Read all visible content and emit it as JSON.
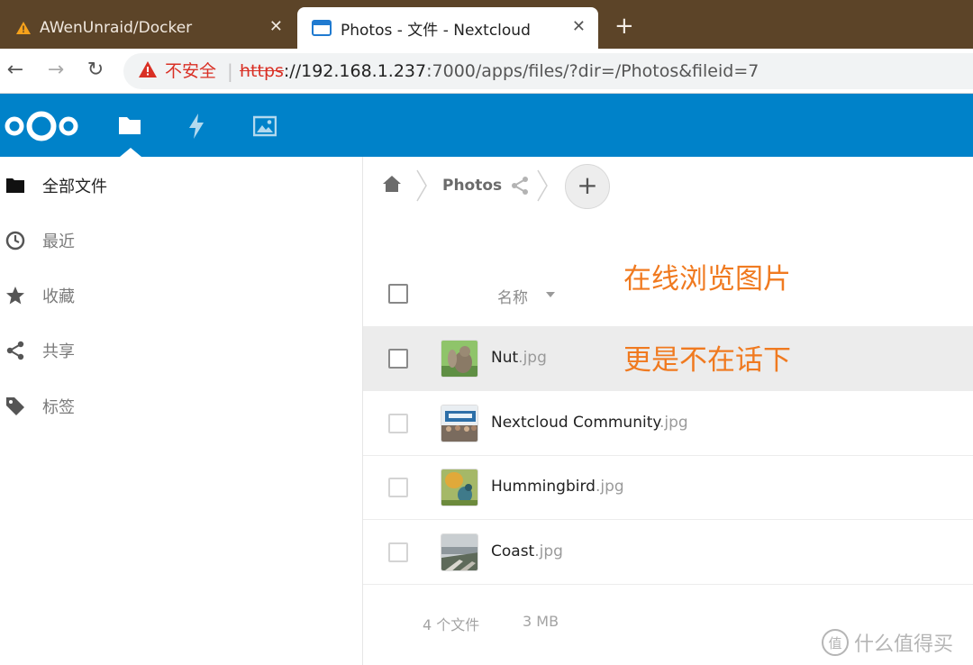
{
  "browser": {
    "tabs": [
      {
        "title": "AWenUnraid/Docker",
        "active": false
      },
      {
        "title": "Photos - 文件 - Nextcloud",
        "active": true
      }
    ],
    "close_glyph": "✕",
    "new_tab_glyph": "+",
    "nav": {
      "back": "←",
      "forward": "→",
      "reload": "↻"
    },
    "security_label": "不安全",
    "address_separator": "|",
    "url": {
      "scheme": "https",
      "host_rest": "://192.168.1.237",
      "path": ":7000/apps/files/?dir=/Photos&fileid=7"
    }
  },
  "header": {
    "brand_color": "#0082c9",
    "logo": "nextcloud-logo",
    "apps": [
      "files-app",
      "activity-app",
      "gallery-app"
    ]
  },
  "sidebar": {
    "items": [
      {
        "label": "全部文件",
        "icon": "folder-icon",
        "active": true
      },
      {
        "label": "最近",
        "icon": "clock-icon",
        "active": false
      },
      {
        "label": "收藏",
        "icon": "star-icon",
        "active": false
      },
      {
        "label": "共享",
        "icon": "share-icon",
        "active": false
      },
      {
        "label": "标签",
        "icon": "tag-icon",
        "active": false
      }
    ]
  },
  "breadcrumb": {
    "current": "Photos",
    "add_glyph": "+"
  },
  "file_list": {
    "column_name": "名称",
    "files": [
      {
        "base": "Nut",
        "ext": ".jpg",
        "thumb": "squirrel"
      },
      {
        "base": "Nextcloud Community",
        "ext": ".jpg",
        "thumb": "crowd"
      },
      {
        "base": "Hummingbird",
        "ext": ".jpg",
        "thumb": "bird"
      },
      {
        "base": "Coast",
        "ext": ".jpg",
        "thumb": "coast"
      }
    ],
    "summary_files": "4 个文件",
    "summary_size": "3 MB"
  },
  "annotations": {
    "line1": "在线浏览图片",
    "line2": "更是不在话下",
    "color": "#f07a20"
  },
  "watermark": {
    "text": "什么值得买",
    "badge": "值"
  }
}
